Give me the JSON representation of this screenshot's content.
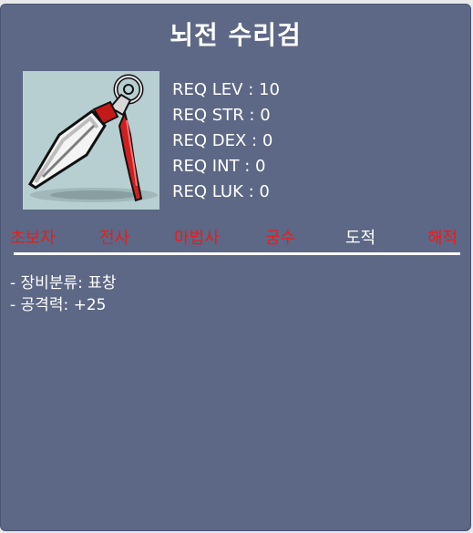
{
  "item": {
    "name": "뇌전 수리검",
    "icon": "throwing-star-dart-icon"
  },
  "requirements": [
    {
      "label": "REQ LEV : 10"
    },
    {
      "label": "REQ STR : 0"
    },
    {
      "label": "REQ DEX : 0"
    },
    {
      "label": "REQ INT : 0"
    },
    {
      "label": "REQ LUK : 0"
    }
  ],
  "jobs": [
    {
      "label": "초보자",
      "allowed": false
    },
    {
      "label": "전사",
      "allowed": false
    },
    {
      "label": "마법사",
      "allowed": false
    },
    {
      "label": "궁수",
      "allowed": false
    },
    {
      "label": "도적",
      "allowed": true
    },
    {
      "label": "해적",
      "allowed": false
    }
  ],
  "info": [
    {
      "text": "- 장비분류: 표창"
    },
    {
      "text": "- 공격력: +25"
    }
  ],
  "colors": {
    "background": "#5c6885",
    "job_disallowed": "#ee1a1a",
    "job_allowed": "#ffffff",
    "icon_background": "#b7cfd1"
  }
}
